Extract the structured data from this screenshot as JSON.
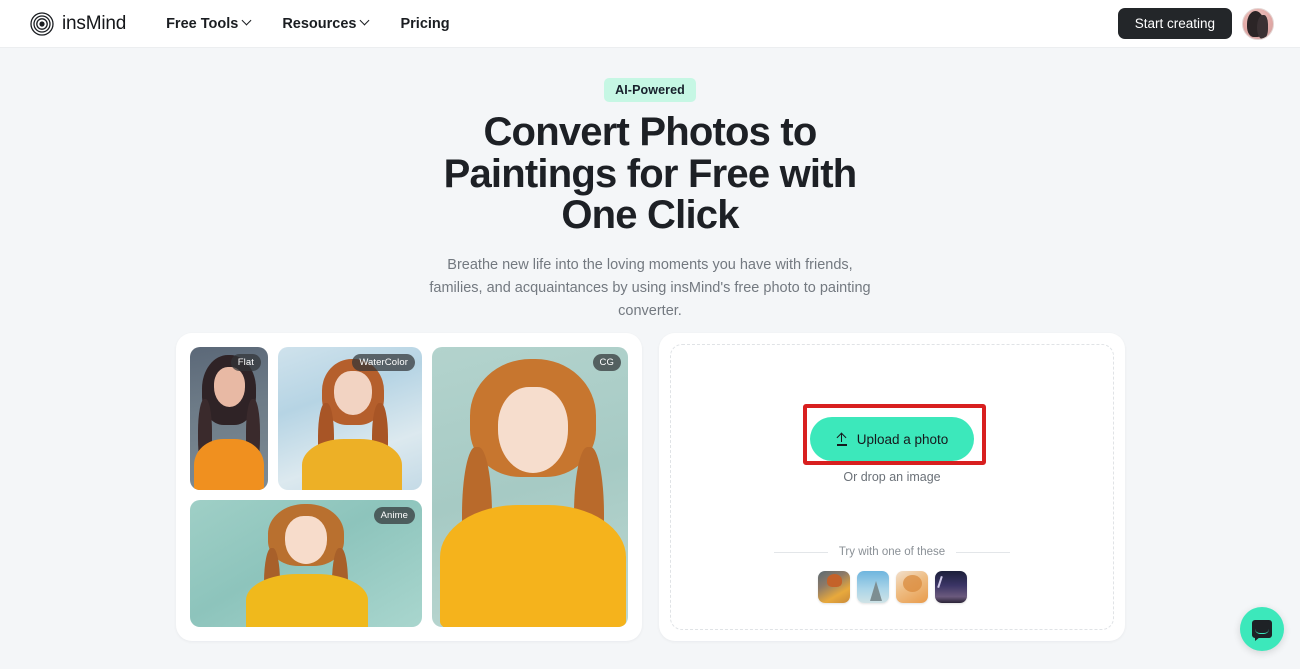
{
  "header": {
    "logo_text": "insMind",
    "nav": [
      {
        "label": "Free Tools",
        "has_chevron": true
      },
      {
        "label": "Resources",
        "has_chevron": true
      },
      {
        "label": "Pricing",
        "has_chevron": false
      }
    ],
    "cta_label": "Start creating",
    "avatar_name": "user-avatar"
  },
  "hero": {
    "badge": "AI-Powered",
    "headline": "Convert Photos to Paintings for Free with One Click",
    "subhead": "Breathe new life into the loving moments you have with friends, families, and acquaintances by using insMind's free photo to painting converter."
  },
  "gallery": {
    "tiles": [
      {
        "label": "Flat",
        "style": "flat"
      },
      {
        "label": "WaterColor",
        "style": "watercolor"
      },
      {
        "label": "Anime",
        "style": "anime"
      },
      {
        "label": "CG",
        "style": "cg"
      }
    ]
  },
  "upload": {
    "button_label": "Upload a photo",
    "upload_icon": "upload-arrow-icon",
    "drop_hint": "Or drop an image",
    "try_label": "Try with one of these",
    "samples": [
      {
        "name": "sample-girl-orange"
      },
      {
        "name": "sample-eiffel-tower"
      },
      {
        "name": "sample-woman-sweater"
      },
      {
        "name": "sample-night-sky"
      }
    ]
  },
  "annotation": {
    "target": "upload-a-photo-button",
    "color": "#d81f1f"
  },
  "chat": {
    "icon": "chat-bubble-icon"
  },
  "colors": {
    "page_bg": "#f4f6f8",
    "accent_mint": "#3ce8bb",
    "badge_mint": "#c6f7e4",
    "dark": "#232629",
    "annotation_red": "#d81f1f"
  }
}
